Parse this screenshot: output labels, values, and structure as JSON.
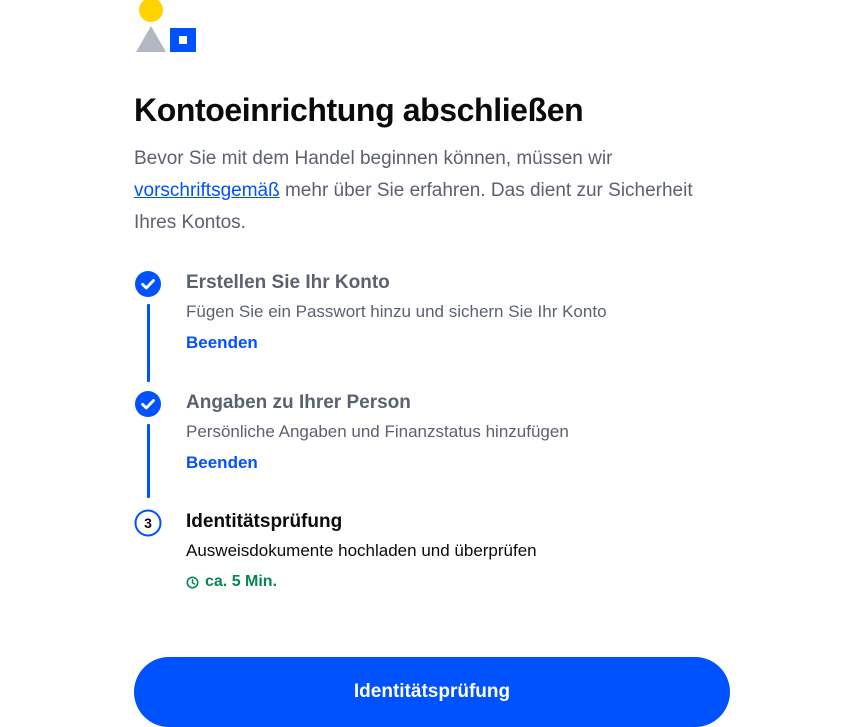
{
  "header": {
    "title": "Kontoeinrichtung abschließen",
    "intro_before": "Bevor Sie mit dem Handel beginnen können, müssen wir ",
    "intro_link": "vorschriftsgemäß",
    "intro_after": " mehr über Sie erfahren. Das dient zur Sicherheit Ihres Kontos."
  },
  "steps": [
    {
      "status": "completed",
      "icon": "check-circle-icon",
      "title": "Erstellen Sie Ihr Konto",
      "description": "Fügen Sie ein Passwort hinzu und sichern Sie Ihr Konto",
      "action": "Beenden"
    },
    {
      "status": "completed",
      "icon": "check-circle-icon",
      "title": "Angaben zu Ihrer Person",
      "description": "Persönliche Angaben und Finanzstatus hinzufügen",
      "action": "Beenden"
    },
    {
      "status": "current",
      "number": "3",
      "title": "Identitätsprüfung",
      "description": "Ausweisdokumente hochladen und überprüfen",
      "time_icon": "clock-icon",
      "time": "ca. 5 Min."
    }
  ],
  "primary_button": {
    "label": "Identitätsprüfung"
  },
  "colors": {
    "accent": "#0052ff",
    "success_time": "#098551",
    "logo_yellow": "#ffd200",
    "logo_grey": "#b1b7c3"
  }
}
